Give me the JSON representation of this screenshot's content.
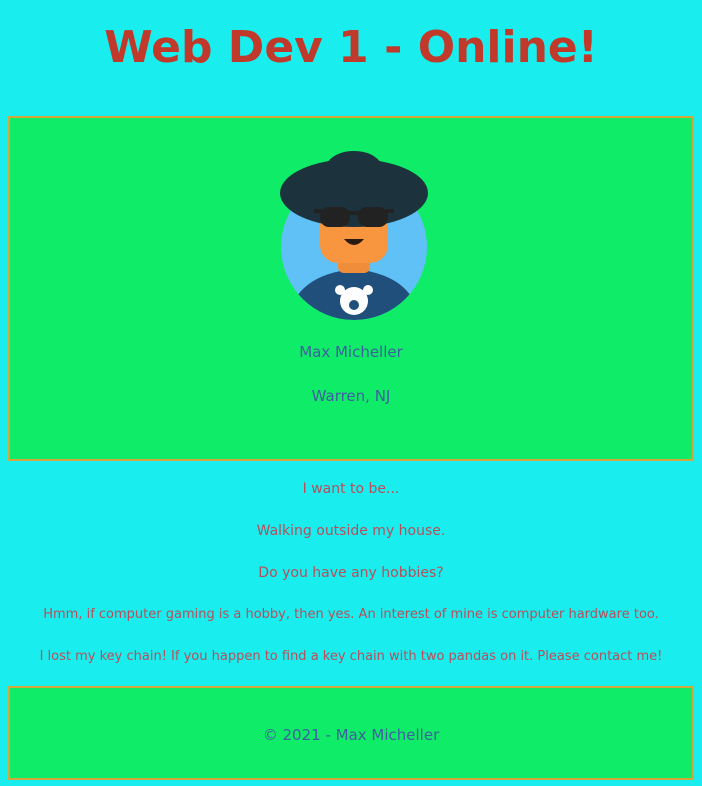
{
  "header": {
    "title": "Web Dev 1 - Online!"
  },
  "profile": {
    "avatar_icon": "avatar-illustration",
    "name": "Max Micheller",
    "location": "Warren, NJ"
  },
  "about": {
    "lines": [
      "I want to be...",
      "Walking outside my house.",
      "Do you have any hobbies?",
      "Hmm, if computer gaming is a hobby, then yes. An interest of mine is computer hardware too.",
      "I lost my key chain! If you happen to find a key chain with two pandas on it. Please contact me!"
    ]
  },
  "footer": {
    "text": "© 2021 - Max Micheller"
  },
  "colors": {
    "background": "#19edee",
    "card_background": "#0fec67",
    "card_border": "#d4a73c",
    "title": "#c0392b",
    "blue_text": "#3d5fa0",
    "body_text": "#b84e5b"
  }
}
